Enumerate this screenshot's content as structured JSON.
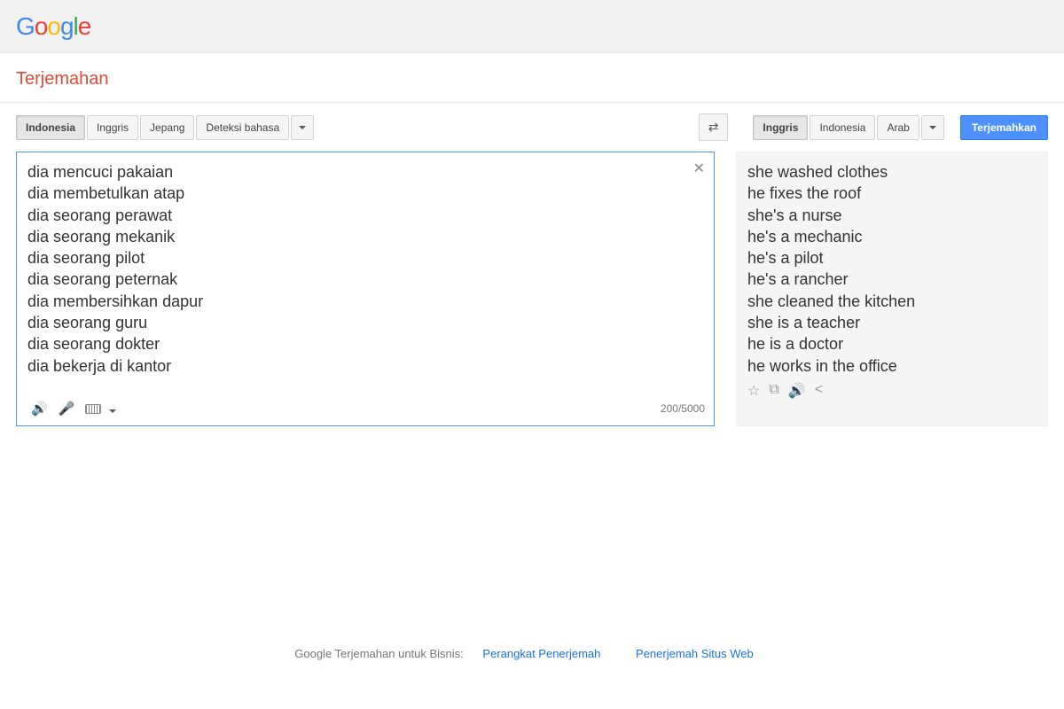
{
  "logo_letters": [
    "G",
    "o",
    "o",
    "g",
    "l",
    "e"
  ],
  "page_title": "Terjemahan",
  "source_langs": {
    "active": "Indonesia",
    "tabs": [
      "Indonesia",
      "Inggris",
      "Jepang",
      "Deteksi bahasa"
    ]
  },
  "target_langs": {
    "active": "Inggris",
    "tabs": [
      "Inggris",
      "Indonesia",
      "Arab"
    ]
  },
  "translate_button": "Terjemahkan",
  "source_text": "dia mencuci pakaian\ndia membetulkan atap\ndia seorang perawat\ndia seorang mekanik\ndia seorang pilot\ndia seorang peternak\ndia membersihkan dapur\ndia seorang guru\ndia seorang dokter\ndia bekerja di kantor",
  "target_text": "she washed clothes\nhe fixes the roof\nshe's a nurse\nhe's a mechanic\nhe's a pilot\nhe's a rancher\nshe cleaned the kitchen\nshe is a teacher\nhe is a doctor\nhe works in the office",
  "char_count": "200/5000",
  "footer": {
    "label": "Google Terjemahan untuk Bisnis:",
    "links": [
      "Perangkat Penerjemah",
      "Penerjemah Situs Web"
    ]
  }
}
